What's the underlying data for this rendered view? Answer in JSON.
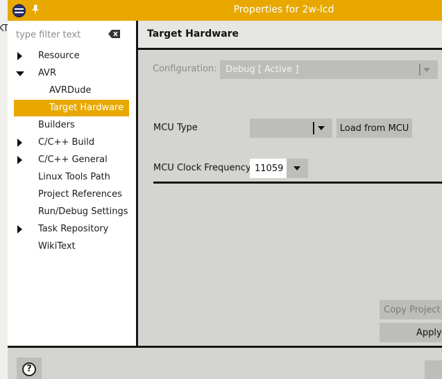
{
  "window": {
    "title": "Properties for 2w-lcd",
    "left_fragment": "KT"
  },
  "filter": {
    "placeholder": "type filter text"
  },
  "tree": {
    "items": [
      {
        "label": "Resource",
        "expander": "collapsed"
      },
      {
        "label": "AVR",
        "expander": "expanded"
      },
      {
        "label": "AVRDude",
        "expander": "none"
      },
      {
        "label": "Target Hardware",
        "expander": "none",
        "selected": true
      },
      {
        "label": "Builders",
        "expander": "none"
      },
      {
        "label": "C/C++ Build",
        "expander": "collapsed"
      },
      {
        "label": "C/C++ General",
        "expander": "collapsed"
      },
      {
        "label": "Linux Tools Path",
        "expander": "none"
      },
      {
        "label": "Project References",
        "expander": "none"
      },
      {
        "label": "Run/Debug Settings",
        "expander": "none"
      },
      {
        "label": "Task Repository",
        "expander": "collapsed"
      },
      {
        "label": "WikiText",
        "expander": "none"
      }
    ]
  },
  "page": {
    "title": "Target Hardware",
    "configuration_label": "Configuration:",
    "configuration_value": "Debug  [ Active ]",
    "mcu_type_label": "MCU Type",
    "mcu_type_value": "",
    "load_from_mcu_label": "Load from MCU",
    "clock_label": "MCU Clock Frequency",
    "clock_value": "11059",
    "copy_label": "Copy Project Settings",
    "apply_label": "Apply"
  },
  "footer": {
    "help_label": "?"
  },
  "colors": {
    "accent": "#e8a800",
    "panel": "#d4d4d0",
    "control": "#bdbdb9"
  }
}
